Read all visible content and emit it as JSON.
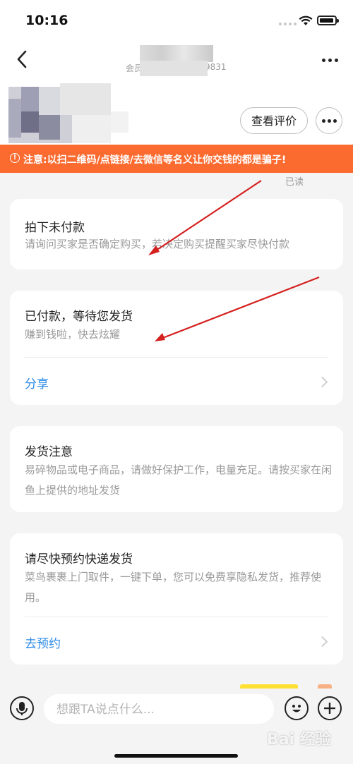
{
  "status_bar": {
    "time": "10:16"
  },
  "nav": {
    "sub_left": "会员",
    "sub_right": "9831"
  },
  "header": {
    "review_button": "查看评价"
  },
  "warning": {
    "icon": "!",
    "text": "注意:以扫二维码/点链接/去微信等名义让你交钱的都是骗子!"
  },
  "read_status": "已读",
  "cards": [
    {
      "title": "拍下未付款",
      "desc": "请询问买家是否确定购买，若决定购买提醒买家尽快付款"
    },
    {
      "title": "已付款，等待您发货",
      "desc": "赚到钱啦，快去炫耀",
      "link": "分享"
    },
    {
      "title": "发货注意",
      "desc": "易碎物品或电子商品，请做好保护工作，电量充足。请按买家在闲鱼上提供的地址发货"
    },
    {
      "title": "请尽快预约快递发货",
      "desc": "菜鸟裹裹上门取件，一键下单，您可以免费享隐私发货，推荐使用。",
      "link": "去预约"
    }
  ],
  "input": {
    "placeholder": "想跟TA说点什么..."
  },
  "watermark": "Bai 经验",
  "colors": {
    "warning": "#fb6b30",
    "link": "#2d8be8",
    "annotation_arrow": "#d4201f"
  }
}
